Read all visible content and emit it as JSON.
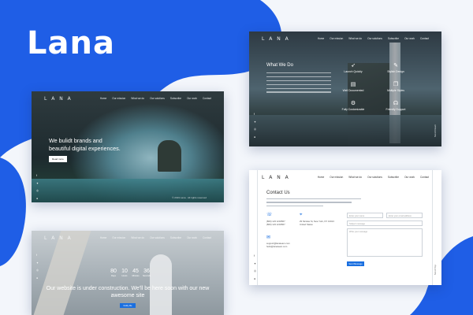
{
  "brand": {
    "name": "Lana",
    "color": "#1f5ee6"
  },
  "menu": [
    "Home",
    "Our mission",
    "What we do",
    "Our solutions",
    "Subscribe",
    "Our work",
    "Contact"
  ],
  "social_icons": [
    "facebook-icon",
    "twitter-icon",
    "instagram-icon",
    "pinterest-icon"
  ],
  "hero": {
    "headline_line1": "We bulidt brands and",
    "headline_line2": "beautiful digital experiences.",
    "button": "Read more",
    "copyright": "© 2019 Lana · All rights reserved"
  },
  "services": {
    "title": "What We Do",
    "features": [
      {
        "icon": "rocket-icon",
        "label": "Launch Quickly"
      },
      {
        "icon": "stylish-icon",
        "label": "Stylish Design"
      },
      {
        "icon": "book-icon",
        "label": "Well Documented"
      },
      {
        "icon": "chat-icon",
        "label": "Multiple Styles"
      },
      {
        "icon": "gear-icon",
        "label": "Fully Customizable"
      },
      {
        "icon": "headset-icon",
        "label": "Friendly Support"
      }
    ],
    "scroll_label": "Scroll Down"
  },
  "contact": {
    "title": "Contact Us",
    "phone": [
      "(800) 123 1234567",
      "(800) 123 1234567"
    ],
    "address": [
      "29 Nicolas St, New York, NY 10013",
      "United States"
    ],
    "email": [
      "support@lanateam.com",
      "hello@lanateam.com"
    ],
    "fields": {
      "first_name": "Enter your name",
      "email": "Enter your email address",
      "subject": "Subject message",
      "message": "Write your message"
    },
    "send_button": "Send Message",
    "scroll_label": "Scroll Top"
  },
  "construction": {
    "counters": [
      {
        "value": "80",
        "unit": "Days"
      },
      {
        "value": "10",
        "unit": "Hours"
      },
      {
        "value": "45",
        "unit": "Minutes"
      },
      {
        "value": "36",
        "unit": "Seconds"
      }
    ],
    "message_line1": "Our website is under construction. We'll be here soon with our new",
    "message_line2": "awesome site",
    "notify_button": "Notify Me"
  }
}
